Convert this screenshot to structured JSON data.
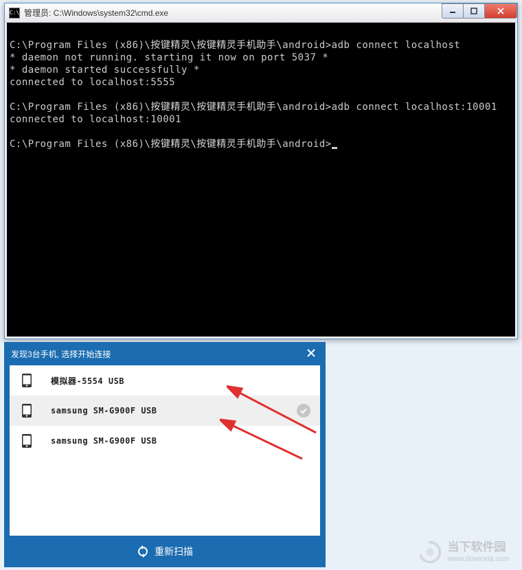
{
  "cmd": {
    "icon_label": "C:\\",
    "title": "管理员: C:\\Windows\\system32\\cmd.exe",
    "lines": [
      {
        "type": "plain",
        "text": ""
      },
      {
        "type": "cmd",
        "prefix": "C:\\Program Files (x86)\\",
        "chn": "按键精灵\\按键精灵手机助手",
        "suffix": "\\android>adb connect localhost"
      },
      {
        "type": "plain",
        "text": "* daemon not running. starting it now on port 5037 *"
      },
      {
        "type": "plain",
        "text": "* daemon started successfully *"
      },
      {
        "type": "plain",
        "text": "connected to localhost:5555"
      },
      {
        "type": "plain",
        "text": ""
      },
      {
        "type": "cmd",
        "prefix": "C:\\Program Files (x86)\\",
        "chn": "按键精灵\\按键精灵手机助手",
        "suffix": "\\android>adb connect localhost:10001"
      },
      {
        "type": "plain",
        "text": "connected to localhost:10001"
      },
      {
        "type": "plain",
        "text": ""
      },
      {
        "type": "prompt",
        "prefix": "C:\\Program Files (x86)\\",
        "chn": "按键精灵\\按键精灵手机助手",
        "suffix": "\\android>"
      }
    ]
  },
  "phone": {
    "header": "发现3台手机, 选择开始连接",
    "devices": [
      {
        "label": "模拟器-5554  USB",
        "selected": false,
        "checked": false
      },
      {
        "label": "samsung  SM-G900F  USB",
        "selected": true,
        "checked": true
      },
      {
        "label": "samsung  SM-G900F  USB",
        "selected": false,
        "checked": false
      }
    ],
    "rescan": "重新扫描"
  },
  "watermark": {
    "name": "当下软件园",
    "url": "www.downxia.com"
  }
}
